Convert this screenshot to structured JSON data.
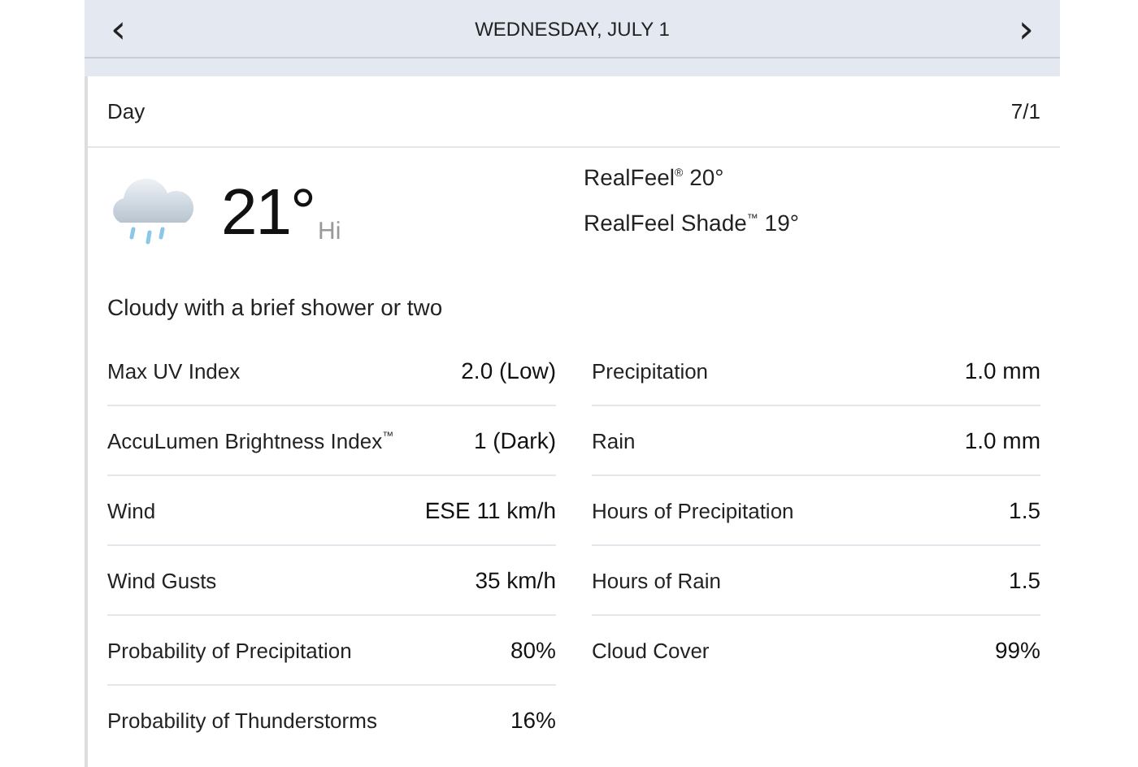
{
  "header": {
    "prev": "‹",
    "title": "WEDNESDAY, JULY 1",
    "next": "›"
  },
  "card": {
    "period": "Day",
    "date": "7/1",
    "temperature": "21°",
    "temp_label": "Hi",
    "realfeel": [
      "RealFeel$^{®}$ 20°",
      "RealFeel Shade$^{™}$ 19°"
    ],
    "phrase": "Cloudy with a brief shower or two",
    "left": [
      {
        "label": "Max UV Index",
        "value": "2.0 (Low)"
      },
      {
        "label": "AccuLumen Brightness Index$^{™}$",
        "value": "1 (Dark)"
      },
      {
        "label": "Wind",
        "value": "ESE 11 km/h"
      },
      {
        "label": "Wind Gusts",
        "value": "35 km/h"
      },
      {
        "label": "Probability of Precipitation",
        "value": "80%"
      },
      {
        "label": "Probability of Thunderstorms",
        "value": "16%"
      }
    ],
    "right": [
      {
        "label": "Precipitation",
        "value": "1.0 mm"
      },
      {
        "label": "Rain",
        "value": "1.0 mm"
      },
      {
        "label": "Hours of Precipitation",
        "value": "1.5"
      },
      {
        "label": "Hours of Rain",
        "value": "1.5"
      },
      {
        "label": "Cloud Cover",
        "value": "99%"
      }
    ]
  }
}
